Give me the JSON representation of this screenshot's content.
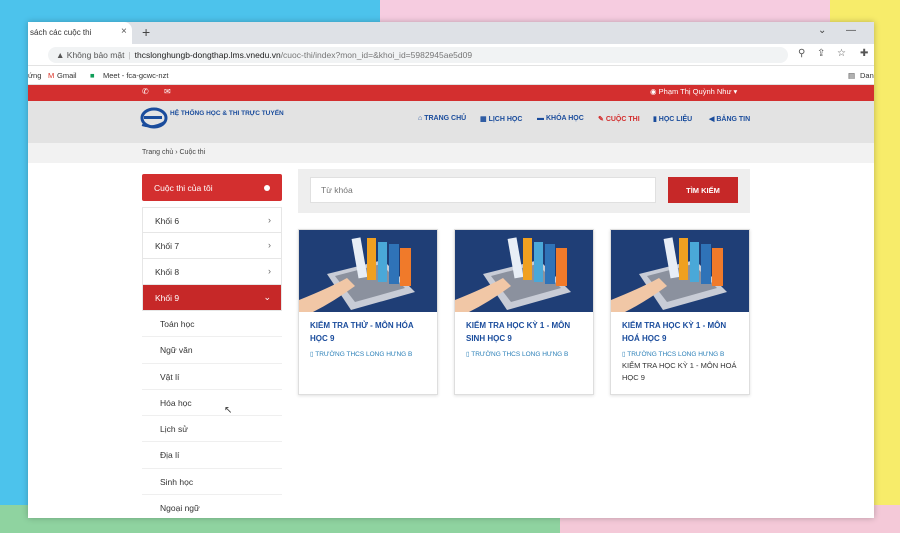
{
  "browser": {
    "tab_title": "sách các cuộc thi",
    "tab_close": "×",
    "new_tab": "+",
    "security": "Không bảo mật",
    "url_host": "thcslonghungb-dongthap.lms.vnedu.vn",
    "url_path": "/cuoc-thi/index?mon_id=&khoi_id=5982945ae5d09",
    "bookmarks": [
      "ứng",
      "Gmail",
      "Meet - fca-gcwc-nzt"
    ],
    "bookmark_right": "Dan"
  },
  "site": {
    "user_name": "Phạm Thị Quỳnh Như ▾",
    "logo_text": "HỆ THỐNG HỌC & THI TRỰC TUYẾN",
    "menu": [
      "TRANG CHỦ",
      "LỊCH HỌC",
      "KHÓA HỌC",
      "CUỘC THI",
      "HỌC LIỆU",
      "BẢNG TIN"
    ],
    "breadcrumb": [
      "Trang chủ",
      "Cuộc thi"
    ]
  },
  "sidebar": {
    "header": "Cuộc thi của tôi",
    "grades": [
      "Khối 6",
      "Khối 7",
      "Khối 8",
      "Khối 9"
    ],
    "subjects": [
      "Toán học",
      "Ngữ văn",
      "Vật lí",
      "Hóa học",
      "Lịch sử",
      "Địa lí",
      "Sinh học",
      "Ngoại ngữ"
    ]
  },
  "search": {
    "placeholder": "Từ khóa",
    "button": "TÌM KIẾM"
  },
  "cards": [
    {
      "title": "KIỂM TRA THỬ - MÔN HÓA HỌC 9",
      "school": "TRƯỜNG THCS LONG HƯNG B",
      "desc": ""
    },
    {
      "title": "KIỂM TRA HỌC KỲ 1 - MÔN SINH HỌC 9",
      "school": "TRƯỜNG THCS LONG HƯNG B",
      "desc": ""
    },
    {
      "title": "KIỂM TRA HỌC KỲ 1 - MÔN HOÁ HỌC 9",
      "school": "TRƯỜNG THCS LONG HƯNG B",
      "desc": "KIỂM TRA HỌC KỲ 1 - MÔN HOÁ HỌC 9"
    }
  ],
  "colors": {
    "primary_red": "#d32f2f",
    "brand_blue": "#1a4c9c",
    "card_bg": "#1f3e76"
  }
}
